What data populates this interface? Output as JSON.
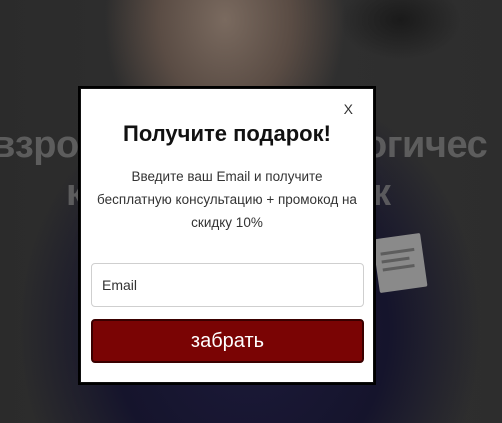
{
  "background": {
    "headline_left": "взро",
    "headline_right": "огичес",
    "headline2_left": "к",
    "headline2_right": "к"
  },
  "popup": {
    "close_label": "X",
    "title": "Получите подарок!",
    "description": "Введите ваш Email и получите бесплатную консультацию + промокод на скидку 10%",
    "email_placeholder": "Email",
    "email_value": "",
    "submit_label": "забрать",
    "accent_color": "#7a0404"
  }
}
